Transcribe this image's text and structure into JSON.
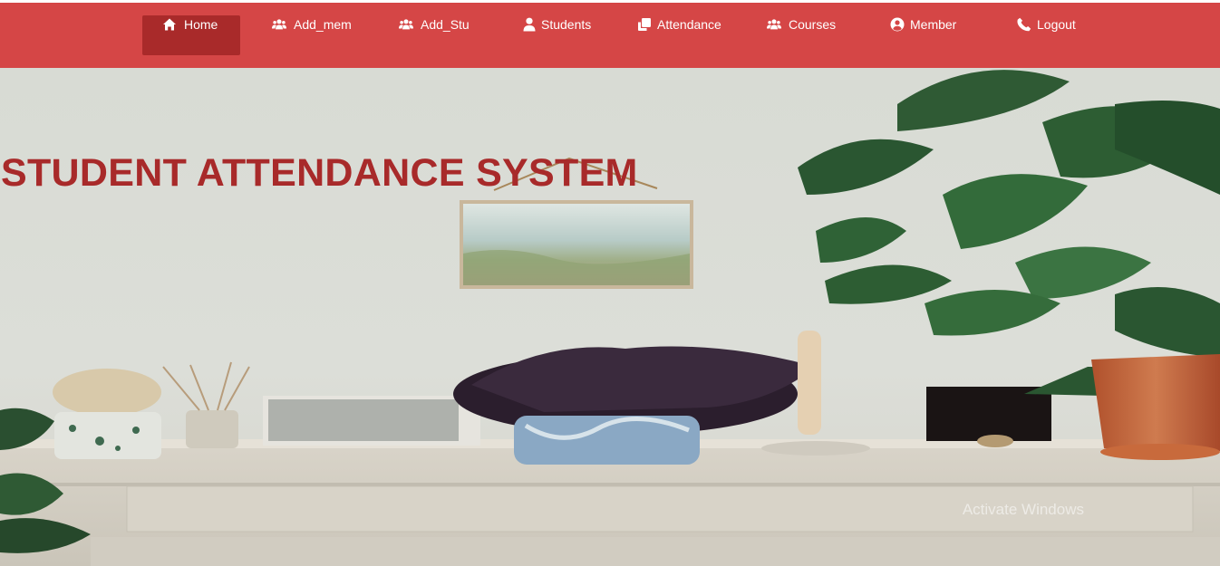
{
  "nav": {
    "items": [
      {
        "label": "Home",
        "icon": "home-icon"
      },
      {
        "label": "Add_mem",
        "icon": "users-icon"
      },
      {
        "label": "Add_Stu",
        "icon": "users-icon"
      },
      {
        "label": "Students",
        "icon": "user-icon"
      },
      {
        "label": "Attendance",
        "icon": "copy-icon"
      },
      {
        "label": "Courses",
        "icon": "users-icon"
      },
      {
        "label": "Member",
        "icon": "user-circle-icon"
      },
      {
        "label": "Logout",
        "icon": "phone-icon"
      }
    ],
    "active": "Home"
  },
  "hero": {
    "title": "STUDENT ATTENDANCE SYSTEM",
    "watermark": "Activate Windows"
  },
  "colors": {
    "navbar": "#d54646",
    "active": "#a92a2a",
    "title": "#a82a2a"
  }
}
